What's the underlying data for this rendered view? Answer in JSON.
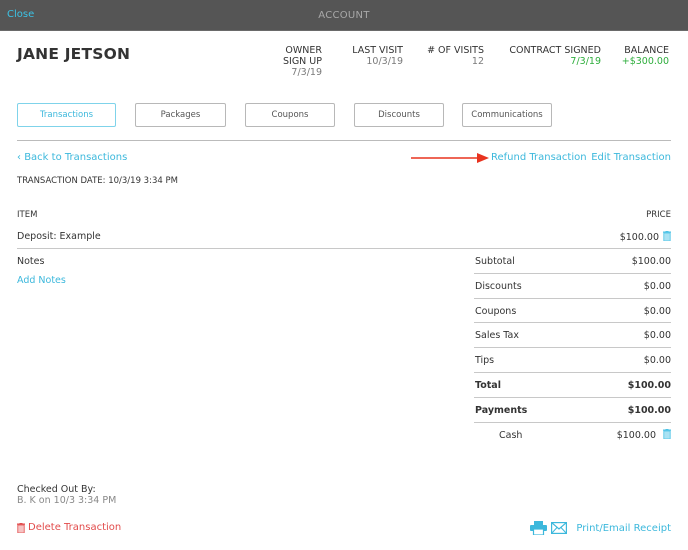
{
  "topbar": {
    "close_label": "Close",
    "title": "ACCOUNT"
  },
  "client": {
    "name": "JANE JETSON"
  },
  "stats": {
    "owner_signup": {
      "label_line1": "OWNER",
      "label_line2": "SIGN UP",
      "value": "7/3/19"
    },
    "last_visit": {
      "label": "LAST VISIT",
      "value": "10/3/19"
    },
    "num_visits": {
      "label": "# OF VISITS",
      "value": "12"
    },
    "contract_signed": {
      "label": "CONTRACT SIGNED",
      "value": "7/3/19"
    },
    "balance": {
      "label": "BALANCE",
      "value": "+$300.00"
    }
  },
  "tabs": [
    {
      "label": "Transactions",
      "active": true
    },
    {
      "label": "Packages",
      "active": false
    },
    {
      "label": "Coupons",
      "active": false
    },
    {
      "label": "Discounts",
      "active": false
    },
    {
      "label": "Communications",
      "active": false
    }
  ],
  "transaction": {
    "back_label": "Back to Transactions",
    "date_label": "TRANSACTION DATE: 10/3/19 3:34 PM",
    "refund_label": "Refund Transaction",
    "edit_label": "Edit Transaction",
    "columns": {
      "item": "ITEM",
      "price": "PRICE"
    },
    "items": [
      {
        "name": "Deposit: Example",
        "price": "$100.00"
      }
    ],
    "notes_label": "Notes",
    "add_notes_label": "Add Notes",
    "summary": [
      {
        "label": "Subtotal",
        "amount": "$100.00"
      },
      {
        "label": "Discounts",
        "amount": "$0.00"
      },
      {
        "label": "Coupons",
        "amount": "$0.00"
      },
      {
        "label": "Sales Tax",
        "amount": "$0.00"
      },
      {
        "label": "Tips",
        "amount": "$0.00"
      },
      {
        "label": "Total",
        "amount": "$100.00"
      },
      {
        "label": "Payments",
        "amount": "$100.00"
      }
    ],
    "payments": [
      {
        "method": "Cash",
        "amount": "$100.00"
      }
    ],
    "checked_out_label": "Checked Out By:",
    "checked_out_value": "B. K on 10/3 3:34 PM",
    "delete_label": "Delete Transaction",
    "receipt_label": "Print/Email Receipt"
  },
  "colors": {
    "accent": "#3cb8dc",
    "positive": "#2fae3d",
    "danger": "#e24b4b",
    "annotation_arrow": "#e8331f",
    "header_bg": "#555555"
  }
}
